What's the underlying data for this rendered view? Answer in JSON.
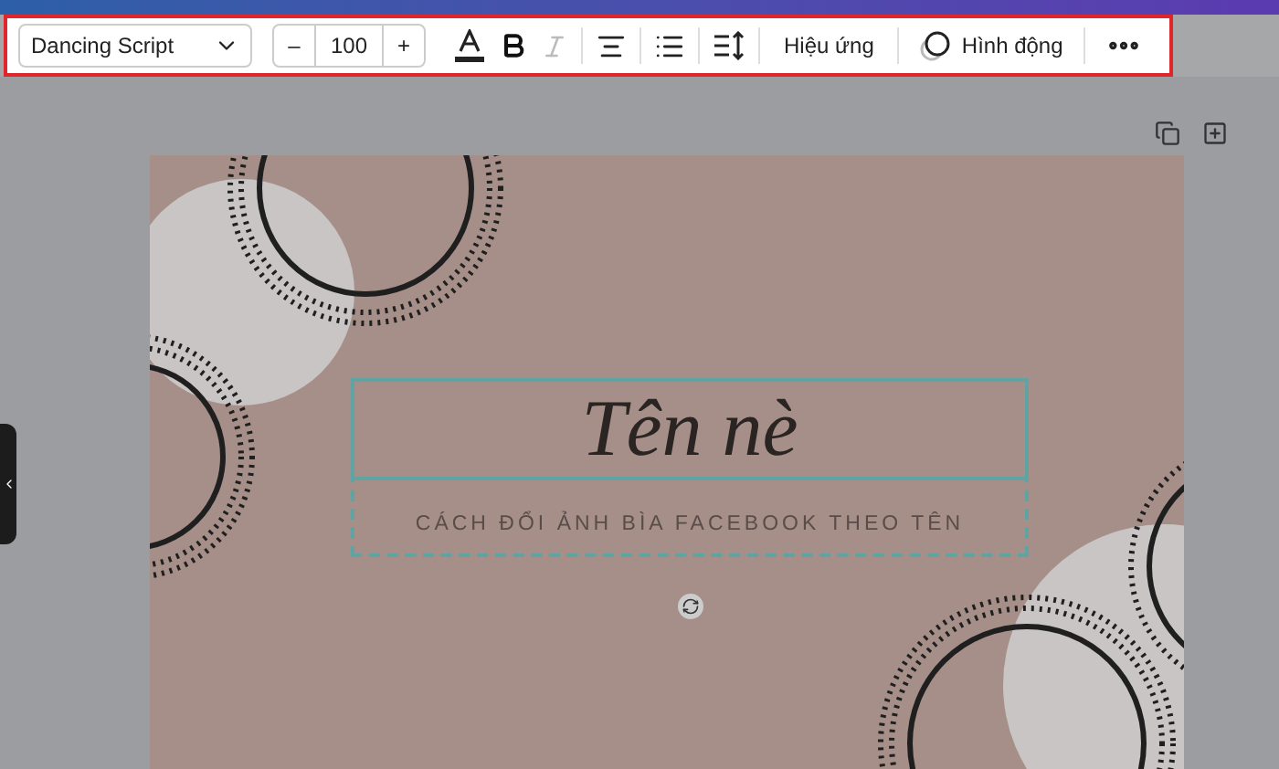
{
  "toolbar": {
    "font_family": "Dancing Script",
    "font_size": "100",
    "decrease_label": "–",
    "increase_label": "+",
    "bold": true,
    "italic_disabled": true,
    "effects_button": "Hiệu ứng",
    "animate_button": "Hình động"
  },
  "canvas": {
    "elements": [
      {
        "kind": "title",
        "text": "Tên nè",
        "selected": true
      },
      {
        "kind": "subtitle",
        "text": "CÁCH ĐỔI ẢNH BÌA FACEBOOK THEO TÊN",
        "selected": false
      }
    ]
  }
}
